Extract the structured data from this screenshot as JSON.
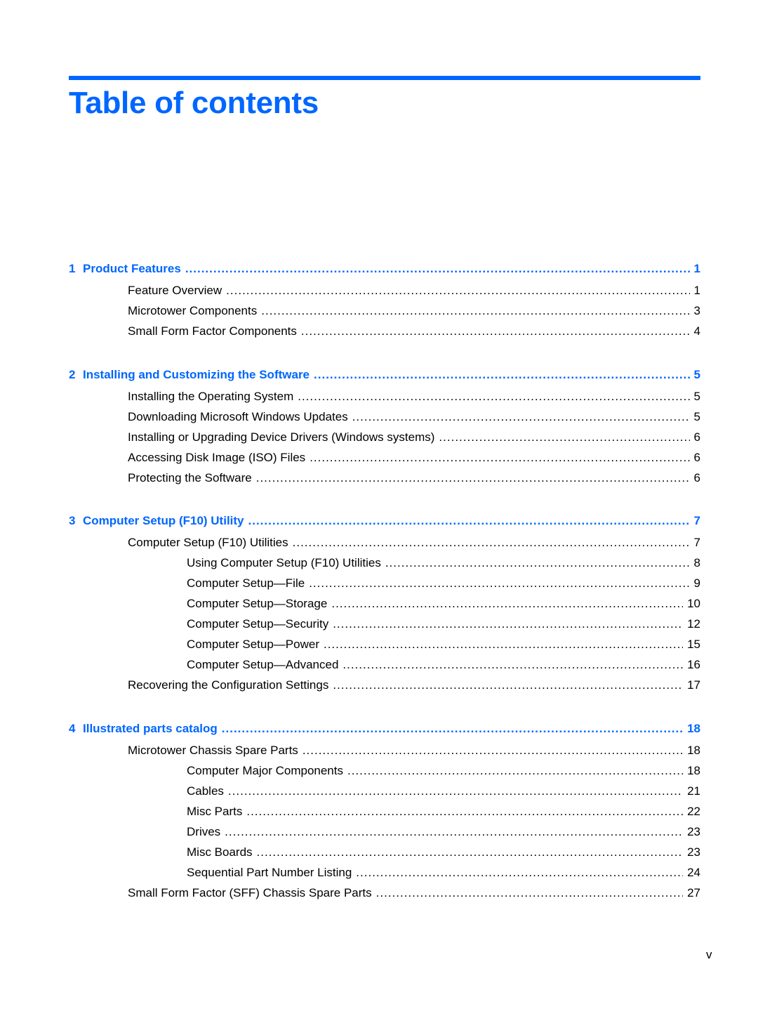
{
  "heading": "Table of contents",
  "accent_color": "#0066ff",
  "chapters": [
    {
      "number": "1",
      "title": "Product Features",
      "page": "1",
      "entries": [
        {
          "title": "Feature Overview",
          "page": "1",
          "level": 1
        },
        {
          "title": "Microtower Components",
          "page": "3",
          "level": 1
        },
        {
          "title": "Small Form Factor Components",
          "page": "4",
          "level": 1
        }
      ]
    },
    {
      "number": "2",
      "title": "Installing and Customizing the Software",
      "page": "5",
      "entries": [
        {
          "title": "Installing the Operating System",
          "page": "5",
          "level": 1
        },
        {
          "title": "Downloading Microsoft Windows Updates",
          "page": "5",
          "level": 1
        },
        {
          "title": "Installing or Upgrading Device Drivers (Windows systems)",
          "page": "6",
          "level": 1
        },
        {
          "title": "Accessing Disk Image (ISO) Files",
          "page": "6",
          "level": 1
        },
        {
          "title": "Protecting the Software",
          "page": "6",
          "level": 1
        }
      ]
    },
    {
      "number": "3",
      "title": "Computer Setup (F10) Utility",
      "page": "7",
      "entries": [
        {
          "title": "Computer Setup (F10) Utilities",
          "page": "7",
          "level": 1
        },
        {
          "title": "Using Computer Setup (F10) Utilities",
          "page": "8",
          "level": 2
        },
        {
          "title": "Computer Setup—File",
          "page": "9",
          "level": 2
        },
        {
          "title": "Computer Setup—Storage",
          "page": "10",
          "level": 2
        },
        {
          "title": "Computer Setup—Security",
          "page": "12",
          "level": 2
        },
        {
          "title": "Computer Setup—Power",
          "page": "15",
          "level": 2
        },
        {
          "title": "Computer Setup—Advanced",
          "page": "16",
          "level": 2
        },
        {
          "title": "Recovering the Configuration Settings",
          "page": "17",
          "level": 1
        }
      ]
    },
    {
      "number": "4",
      "title": "Illustrated parts catalog",
      "page": "18",
      "entries": [
        {
          "title": "Microtower Chassis Spare Parts",
          "page": "18",
          "level": 1
        },
        {
          "title": "Computer Major Components",
          "page": "18",
          "level": 2
        },
        {
          "title": "Cables",
          "page": "21",
          "level": 2
        },
        {
          "title": "Misc Parts",
          "page": "22",
          "level": 2
        },
        {
          "title": "Drives",
          "page": "23",
          "level": 2
        },
        {
          "title": "Misc Boards",
          "page": "23",
          "level": 2
        },
        {
          "title": "Sequential Part Number Listing",
          "page": "24",
          "level": 2
        },
        {
          "title": "Small Form Factor (SFF) Chassis Spare Parts",
          "page": "27",
          "level": 1
        }
      ]
    }
  ],
  "footer": {
    "page_number": "v"
  }
}
